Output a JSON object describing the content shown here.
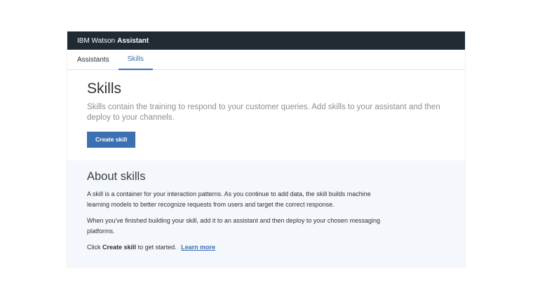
{
  "header": {
    "brand_prefix": "IBM Watson",
    "brand_product": "Assistant"
  },
  "tabs": [
    {
      "label": "Assistants",
      "active": false
    },
    {
      "label": "Skills",
      "active": true
    }
  ],
  "hero": {
    "title": "Skills",
    "description": "Skills contain the training to respond to your customer queries. Add skills to your assistant and then deploy to your channels.",
    "create_button": "Create skill"
  },
  "about": {
    "title": "About skills",
    "paragraph1": "A skill is a container for your interaction patterns. As you continue to add data, the skill builds machine learning models to better recognize requests from users and target the correct response.",
    "paragraph2": "When you've finished building your skill, add it to an assistant and then deploy to your chosen messaging platforms.",
    "cta_prefix": "Click",
    "cta_emphasis": "Create skill",
    "cta_suffix": "to get started.",
    "learn_more": "Learn more"
  },
  "colors": {
    "topbar": "#1f2a33",
    "accent": "#3d70b2",
    "about_background": "#f4f7fb"
  }
}
